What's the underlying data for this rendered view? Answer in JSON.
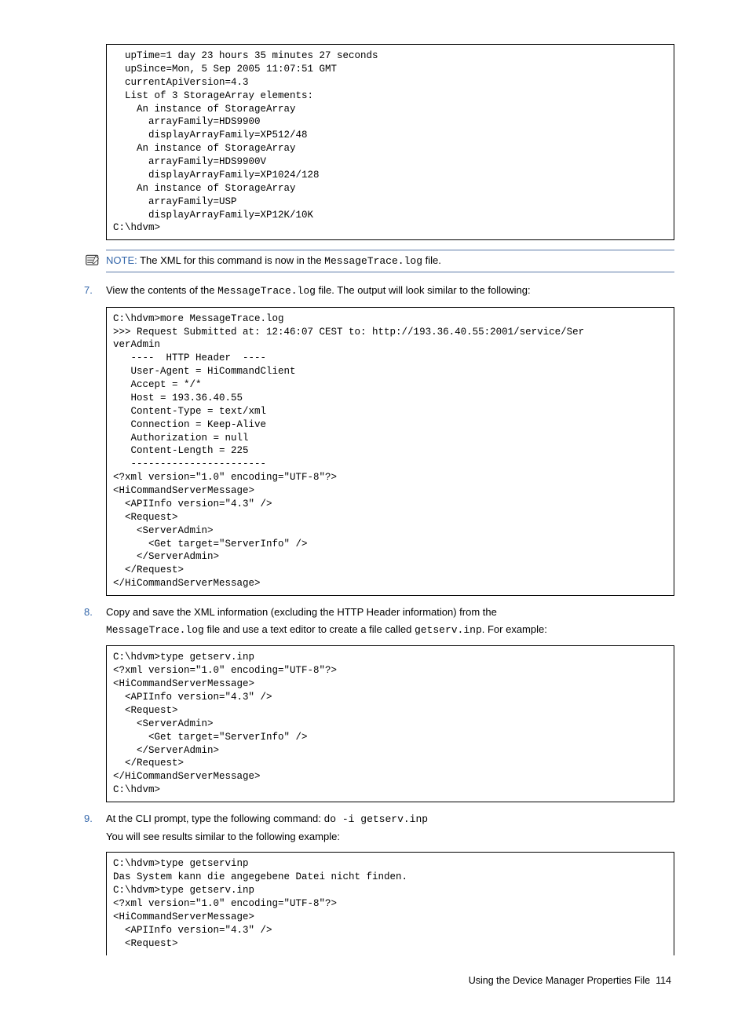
{
  "code1": "  upTime=1 day 23 hours 35 minutes 27 seconds\n  upSince=Mon, 5 Sep 2005 11:07:51 GMT\n  currentApiVersion=4.3\n  List of 3 StorageArray elements:\n    An instance of StorageArray\n      arrayFamily=HDS9900\n      displayArrayFamily=XP512/48\n    An instance of StorageArray\n      arrayFamily=HDS9900V\n      displayArrayFamily=XP1024/128\n    An instance of StorageArray\n      arrayFamily=USP\n      displayArrayFamily=XP12K/10K\nC:\\hdvm>",
  "note": {
    "label": "NOTE:",
    "pre": "  The XML for this command is now in the ",
    "file": "MessageTrace.log",
    "post": " file."
  },
  "step7": {
    "num": "7.",
    "pre": "View the contents of the ",
    "file": "MessageTrace.log",
    "post": " file. The output will look similar to the following:"
  },
  "code2": "C:\\hdvm>more MessageTrace.log\n>>> Request Submitted at: 12:46:07 CEST to: http://193.36.40.55:2001/service/Ser\nverAdmin\n   ----  HTTP Header  ----\n   User-Agent = HiCommandClient\n   Accept = */*\n   Host = 193.36.40.55\n   Content-Type = text/xml\n   Connection = Keep-Alive\n   Authorization = null\n   Content-Length = 225\n   -----------------------\n<?xml version=\"1.0\" encoding=\"UTF-8\"?>\n<HiCommandServerMessage>\n  <APIInfo version=\"4.3\" />\n  <Request>\n    <ServerAdmin>\n      <Get target=\"ServerInfo\" />\n    </ServerAdmin>\n  </Request>\n</HiCommandServerMessage>",
  "step8": {
    "num": "8.",
    "line1": "Copy and save the XML information (excluding the HTTP Header information) from the",
    "file": "MessageTrace.log",
    "mid": " file and use a text editor to create a file called ",
    "file2": "getserv.inp",
    "post": ". For example:"
  },
  "code3": "C:\\hdvm>type getserv.inp\n<?xml version=\"1.0\" encoding=\"UTF-8\"?>\n<HiCommandServerMessage>\n  <APIInfo version=\"4.3\" />\n  <Request>\n    <ServerAdmin>\n      <Get target=\"ServerInfo\" />\n    </ServerAdmin>\n  </Request>\n</HiCommandServerMessage>\nC:\\hdvm>",
  "step9": {
    "num": "9.",
    "pre": "At the CLI prompt, type the following command: ",
    "cmd": "do -i getserv.inp",
    "line2": "You will see results similar to the following example:"
  },
  "code4": "C:\\hdvm>type getservinp\nDas System kann die angegebene Datei nicht finden.\nC:\\hdvm>type getserv.inp\n<?xml version=\"1.0\" encoding=\"UTF-8\"?>\n<HiCommandServerMessage>\n  <APIInfo version=\"4.3\" />\n  <Request>",
  "footer": {
    "title": "Using the Device Manager Properties File",
    "page": "114"
  }
}
